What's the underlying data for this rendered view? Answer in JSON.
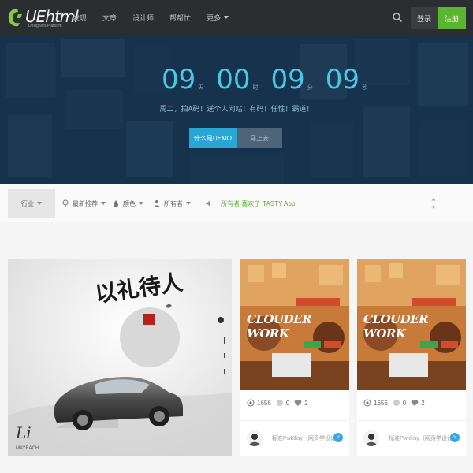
{
  "nav": {
    "logo_text": "UEhtml",
    "logo_sub": "Designers Platform",
    "links": [
      "发现",
      "文章",
      "设计师",
      "帮帮忙",
      "更多"
    ],
    "login_label": "登录",
    "signup_label": "注册"
  },
  "hero": {
    "countdown": [
      {
        "value": "09",
        "unit": "天"
      },
      {
        "value": "00",
        "unit": "时"
      },
      {
        "value": "09",
        "unit": "分"
      },
      {
        "value": "09",
        "unit": "秒"
      }
    ],
    "tagline": "周二，拍A码！送个人网站！有码！任性！霸道！",
    "primary_button": "什么是UEMO",
    "secondary_button": "马上去"
  },
  "filters": {
    "industry_label": "行业",
    "sort_label": "最新推荐",
    "color_label": "颜色",
    "author_label": "所有者",
    "announce_prefix": "所有者 喜欢了",
    "announce_link": "TASTY App"
  },
  "cards": [
    {
      "views": "1656",
      "comments": "0",
      "likes": "2",
      "author": "标准Pwkllisy（网页学设计）",
      "badge": "V",
      "poster": "CLOUDER WORK"
    },
    {
      "views": "1656",
      "comments": "0",
      "likes": "2",
      "author": "标准Pwkllisy（网页学设计）",
      "badge": "V",
      "poster": "CLOUDER WORK"
    }
  ],
  "featured": {
    "calligraphy": "以礼待人",
    "brand": "Li",
    "brand_sub": "MAYBACH"
  },
  "colors": {
    "accent": "#2aa6d5",
    "signup_green": "#5cb531",
    "nav_bg": "#2b2e31",
    "countdown": "#46c8e6"
  }
}
